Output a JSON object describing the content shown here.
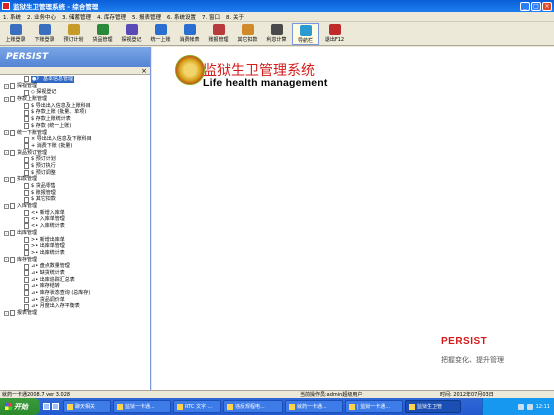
{
  "window": {
    "title": "监狱生卫管理系统 - 综合管理"
  },
  "menu": [
    "1. 系统",
    "2. 业务中心",
    "3. 储蓄管理",
    "4. 库存管理",
    "5. 报表管理",
    "6. 系统设置",
    "7. 窗口",
    "8. 关于"
  ],
  "toolbar": [
    {
      "label": "上账登录",
      "icon": "login-icon",
      "color": "#3a6fc0"
    },
    {
      "label": "下账登录",
      "icon": "logout-icon",
      "color": "#3a6fc0"
    },
    {
      "label": "预订计划",
      "icon": "plan-icon",
      "color": "#c89a2a"
    },
    {
      "label": "货品管理",
      "icon": "goods-icon",
      "color": "#2a8a3a"
    },
    {
      "label": "探视登记",
      "icon": "visit-icon",
      "color": "#5a4ab8"
    },
    {
      "label": "统一上账",
      "icon": "unified-icon",
      "color": "#2a6fd0"
    },
    {
      "label": "消费帐表",
      "icon": "report-icon",
      "color": "#2a6fd0"
    },
    {
      "label": "账报管理",
      "icon": "ledger-icon",
      "color": "#b83a3a"
    },
    {
      "label": "其它扣款",
      "icon": "deduct-icon",
      "color": "#d08a2a"
    },
    {
      "label": "利息计算",
      "icon": "calc-icon",
      "color": "#4a4a4a"
    },
    {
      "label": "导航栏",
      "icon": "nav-icon",
      "color": "#2a9ad0"
    },
    {
      "label": "退出F12",
      "icon": "exit-icon",
      "color": "#c02a2a"
    }
  ],
  "sidebar": {
    "brand": "PERSIST",
    "close": "×",
    "tree": [
      {
        "level": 1,
        "text": "●》 基本信息管理",
        "sel": true
      },
      {
        "level": 0,
        "text": "探视管理"
      },
      {
        "level": 1,
        "text": "◇ 探视登记"
      },
      {
        "level": 0,
        "text": "存款上账管理"
      },
      {
        "level": 1,
        "text": "$ 导出出入信息及上账科目"
      },
      {
        "level": 1,
        "text": "$ 存款上账 (批量、单项)"
      },
      {
        "level": 1,
        "text": "$ 存款上账统计表"
      },
      {
        "level": 1,
        "text": "$ 存款 (统一上账)"
      },
      {
        "level": 0,
        "text": "统一下账管理"
      },
      {
        "level": 1,
        "text": "× 导出出入信息及下账科目"
      },
      {
        "level": 1,
        "text": "+ 消费下账 (批量)"
      },
      {
        "level": 0,
        "text": "货品预订管理"
      },
      {
        "level": 1,
        "text": "$ 预订计划"
      },
      {
        "level": 1,
        "text": "$ 预订执行"
      },
      {
        "level": 1,
        "text": "$ 预订调整"
      },
      {
        "level": 0,
        "text": "扣款管理"
      },
      {
        "level": 1,
        "text": "$ 货品零售"
      },
      {
        "level": 1,
        "text": "$ 账报管理"
      },
      {
        "level": 1,
        "text": "$ 其它扣款"
      },
      {
        "level": 0,
        "text": "入库管理"
      },
      {
        "level": 1,
        "text": "<• 新增入库单"
      },
      {
        "level": 1,
        "text": "<• 入库单管理"
      },
      {
        "level": 1,
        "text": "<• 入库统计表"
      },
      {
        "level": 0,
        "text": "出库管理"
      },
      {
        "level": 1,
        "text": ">• 新增出库单"
      },
      {
        "level": 1,
        "text": ">• 出库单管理"
      },
      {
        "level": 1,
        "text": ">• 出库统计表"
      },
      {
        "level": 0,
        "text": "库存管理"
      },
      {
        "level": 1,
        "text": "⊿• 盘点数量管理"
      },
      {
        "level": 1,
        "text": "⊿• 缺货统计表"
      },
      {
        "level": 1,
        "text": "⊿• 出库追踪汇总表"
      },
      {
        "level": 1,
        "text": "⊿• 库存结转"
      },
      {
        "level": 1,
        "text": "⊿• 库存状态查询 (总库存)"
      },
      {
        "level": 1,
        "text": "⊿• 货品调价单"
      },
      {
        "level": 1,
        "text": "⊿• 月度出入存平衡表"
      },
      {
        "level": 0,
        "text": "报表管理"
      }
    ]
  },
  "main": {
    "title": "监狱生卫管理系统",
    "subtitle": "Life health management",
    "logo": "PERSIST",
    "slogan": "把握变化、提升管理"
  },
  "status": {
    "left": "就药一卡通2008.7 ver 3.028",
    "user": "当前操作员:admin超级用户",
    "time": "时间: 2012年07月03日"
  },
  "taskbar": {
    "start": "开始",
    "tasks": [
      {
        "label": "聊天相关"
      },
      {
        "label": "监狱一卡通..."
      },
      {
        "label": "RTC 文字 ..."
      },
      {
        "label": "违反规程电..."
      },
      {
        "label": "就药一卡通..."
      },
      {
        "label": "| 监狱一卡通..."
      },
      {
        "label": "监狱生卫管",
        "active": true
      }
    ],
    "clock": "12:11"
  }
}
